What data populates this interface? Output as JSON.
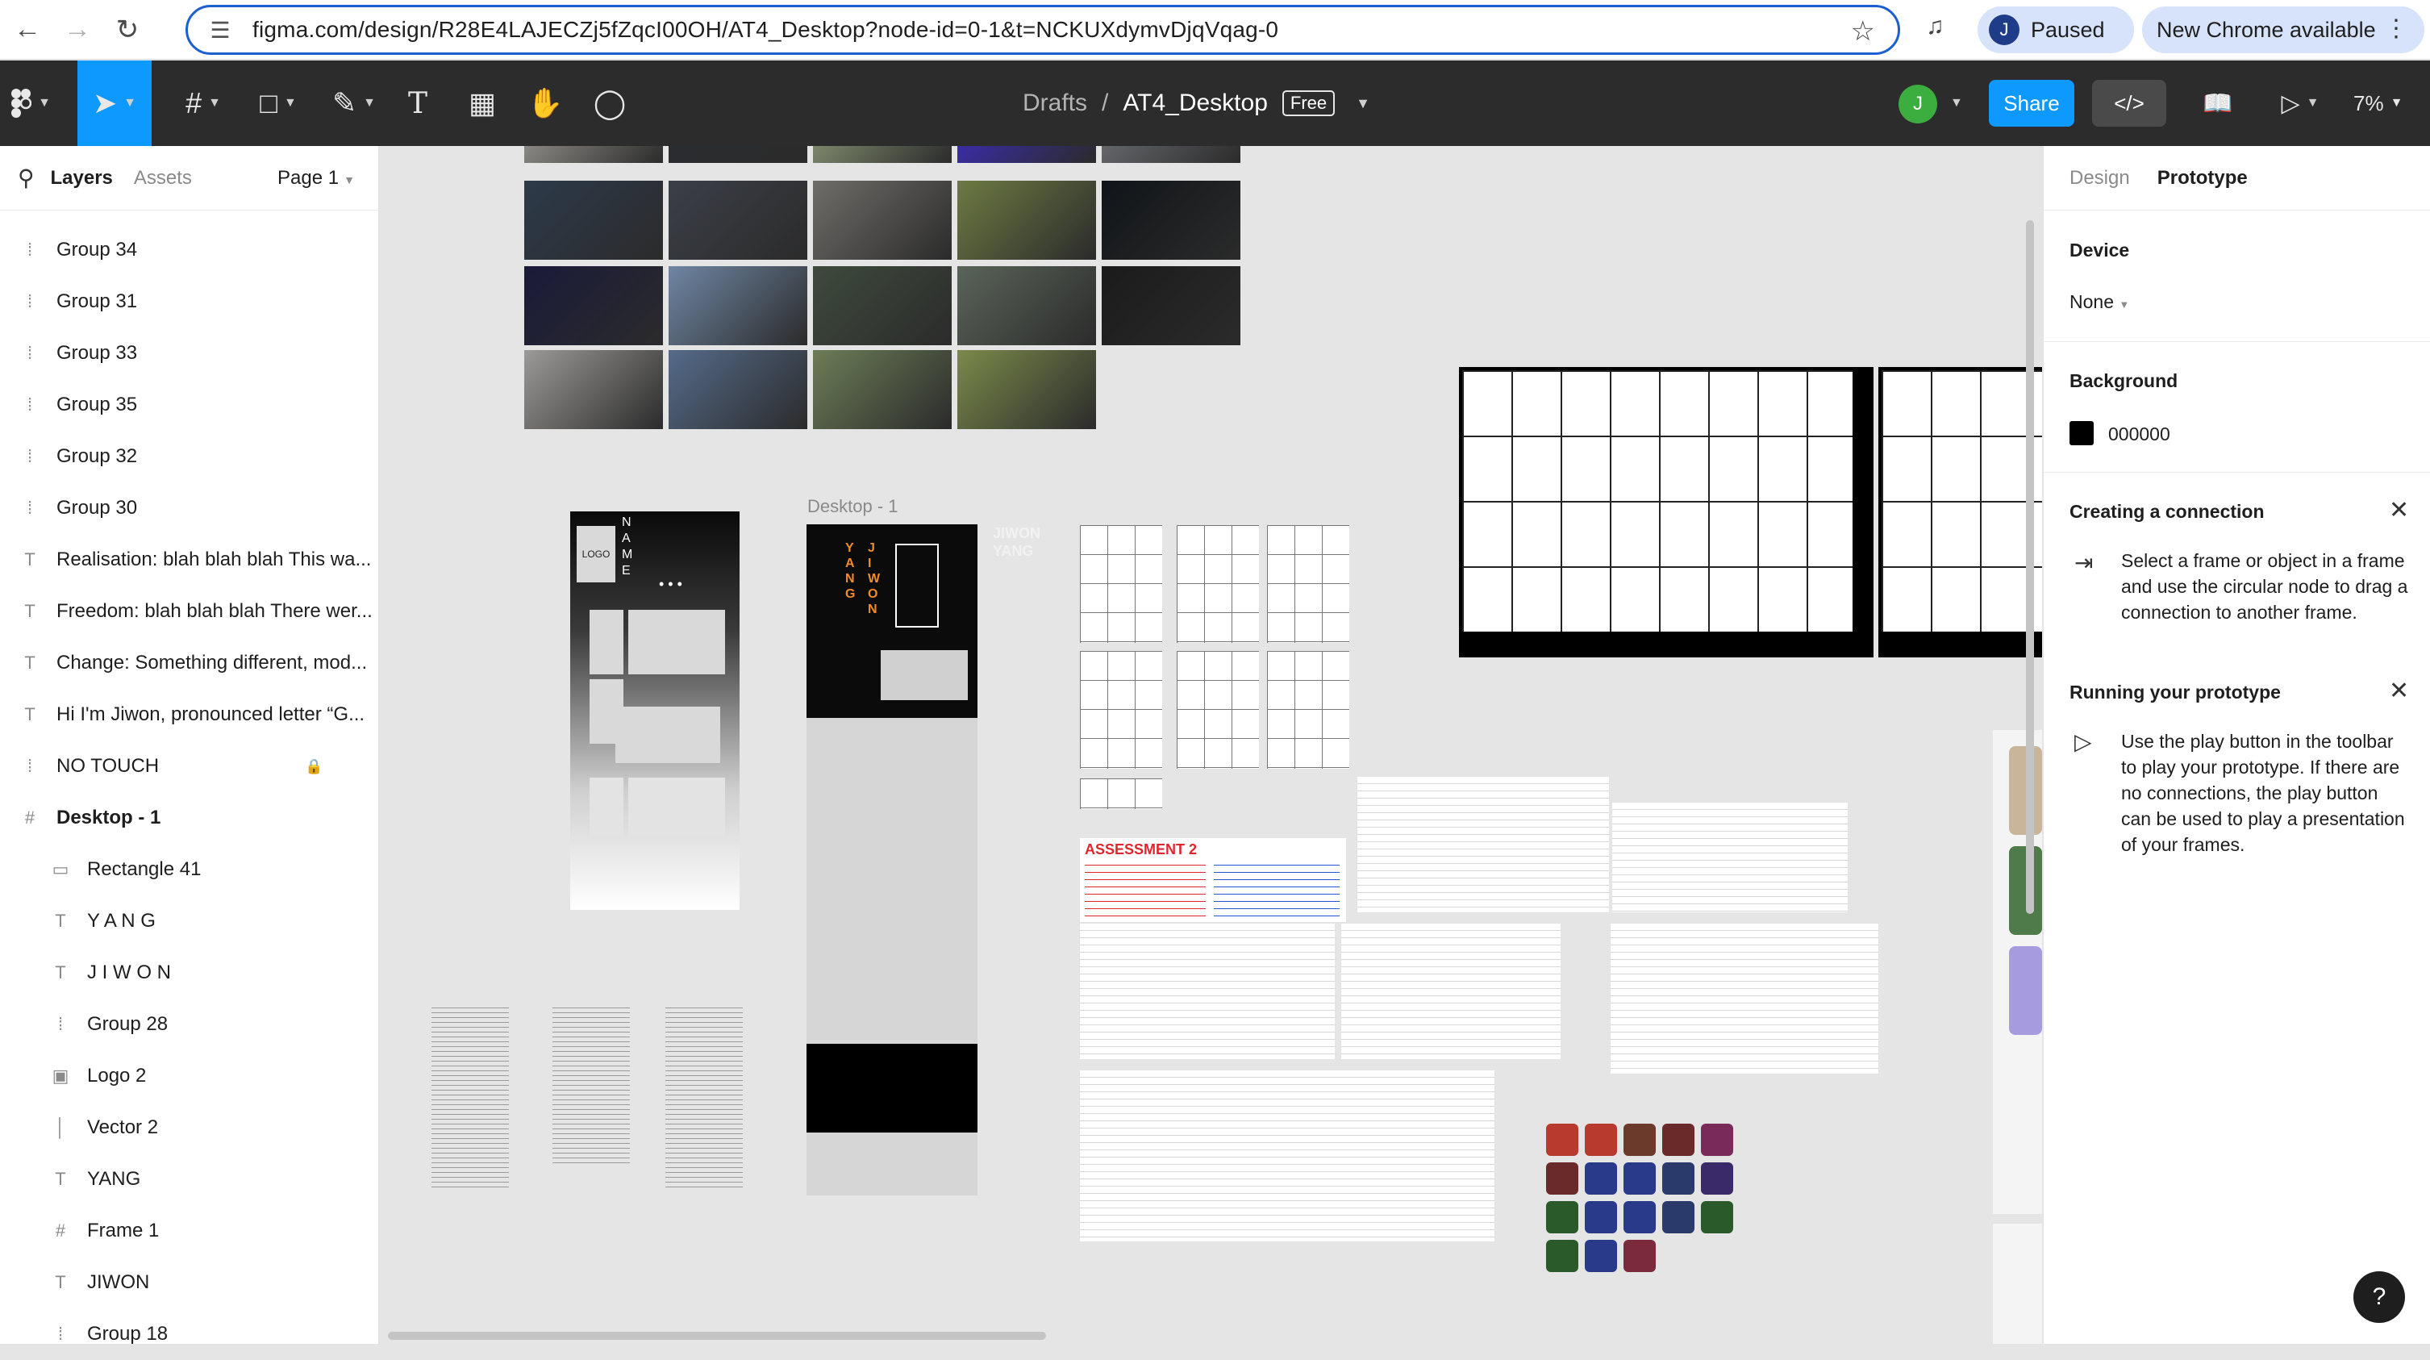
{
  "browser": {
    "url": "figma.com/design/R28E4LAJECZj5fZqcI00OH/AT4_Desktop?node-id=0-1&t=NCKUXdymvDjqVqag-0",
    "profile_initial": "J",
    "paused_label": "Paused",
    "update_label": "New Chrome available"
  },
  "toolbar": {
    "breadcrumb_drafts": "Drafts",
    "breadcrumb_sep": "/",
    "file_name": "AT4_Desktop",
    "plan_badge": "Free",
    "user_initial": "J",
    "share_label": "Share",
    "zoom_level": "7%"
  },
  "left_panel": {
    "tab_layers": "Layers",
    "tab_assets": "Assets",
    "page_selector": "Page 1",
    "layers": [
      {
        "icon": "group",
        "name": "Group 34"
      },
      {
        "icon": "group",
        "name": "Group 31"
      },
      {
        "icon": "group",
        "name": "Group 33"
      },
      {
        "icon": "group",
        "name": "Group 35"
      },
      {
        "icon": "group",
        "name": "Group 32"
      },
      {
        "icon": "group",
        "name": "Group 30"
      },
      {
        "icon": "text",
        "name": "Realisation: blah blah blah This wa..."
      },
      {
        "icon": "text",
        "name": "Freedom: blah blah blah There wer..."
      },
      {
        "icon": "text",
        "name": "Change: Something different, mod..."
      },
      {
        "icon": "text",
        "name": "Hi I'm Jiwon, pronounced letter “G..."
      },
      {
        "icon": "group",
        "name": "NO TOUCH",
        "locked": true
      },
      {
        "icon": "frame",
        "name": "Desktop - 1"
      },
      {
        "icon": "rectangle",
        "name": "Rectangle 41"
      },
      {
        "icon": "text",
        "name": "Y A N G"
      },
      {
        "icon": "text",
        "name": "J I W O N"
      },
      {
        "icon": "group",
        "name": "Group 28"
      },
      {
        "icon": "image",
        "name": "Logo 2"
      },
      {
        "icon": "vector",
        "name": "Vector 2"
      },
      {
        "icon": "text",
        "name": "YANG"
      },
      {
        "icon": "frame",
        "name": "Frame 1"
      },
      {
        "icon": "text",
        "name": "JIWON"
      },
      {
        "icon": "group",
        "name": "Group 18"
      }
    ]
  },
  "canvas": {
    "frame_label": "Desktop - 1",
    "poster_logo": "LOGO",
    "poster_name": "N A M E",
    "poster_dots": "• • •",
    "poster_yang": "Y A N G",
    "poster_jiwon": "J I W O N",
    "faint_jiwon": "JIWON",
    "faint_yang": "YANG",
    "assessment_title": "ASSESSMENT 2"
  },
  "right_panel": {
    "tab_design": "Design",
    "tab_prototype": "Prototype",
    "device_label": "Device",
    "device_value": "None",
    "background_label": "Background",
    "background_value": "000000",
    "background_color": "#000000",
    "connection_title": "Creating a connection",
    "connection_text": "Select a frame or object in a frame and use the circular node to drag a connection to another frame.",
    "running_title": "Running your prototype",
    "running_text": "Use the play button in the toolbar to play your prototype. If there are no connections, the play button can be used to play a presentation of your frames."
  },
  "colors": {
    "accent": "#0d99ff",
    "toolbar_bg": "#2c2c2c",
    "canvas_bg": "#e5e5e5",
    "poster_orange": "#f28c28"
  }
}
